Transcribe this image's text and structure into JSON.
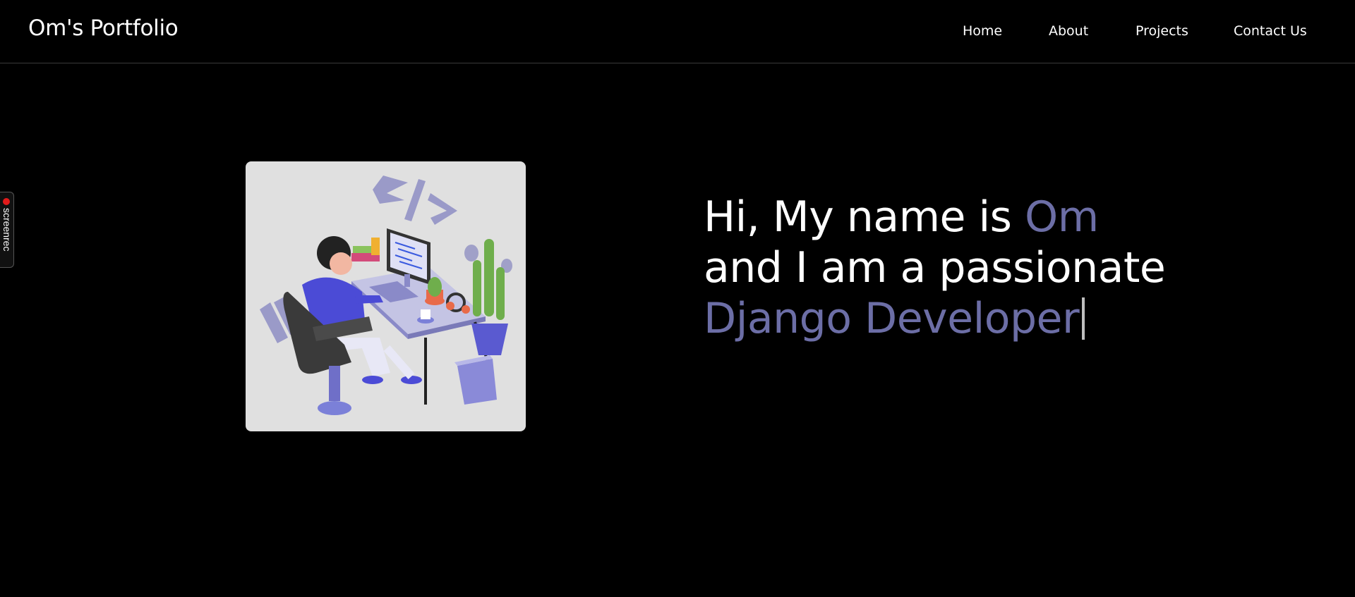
{
  "header": {
    "brand": "Om's Portfolio",
    "nav": [
      "Home",
      "About",
      "Projects",
      "Contact Us"
    ]
  },
  "hero": {
    "greeting": "Hi, My name is ",
    "name": "Om",
    "line2": "and I am a passionate",
    "role": "Django Developer",
    "image_icon": "developer-at-desk-illustration"
  },
  "overlay": {
    "recorder_label": "screenrec"
  },
  "colors": {
    "background": "#000000",
    "accent": "#6c6ea6",
    "image_bg": "#e0e0e0"
  }
}
